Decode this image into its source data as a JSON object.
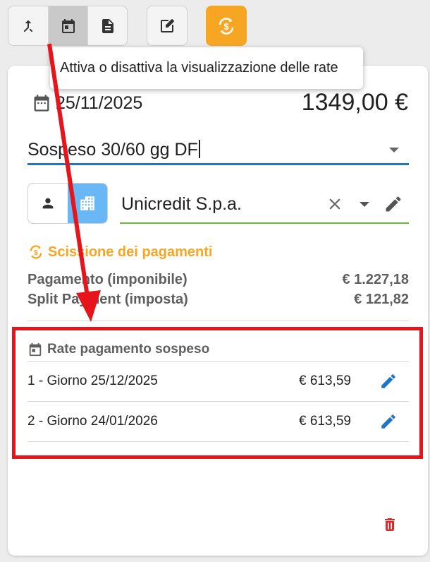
{
  "toolbar": {
    "buttons": [
      {
        "name": "merge-icon",
        "active": false
      },
      {
        "name": "calendar-icon",
        "active": true
      },
      {
        "name": "document-icon",
        "active": false
      }
    ],
    "edit_icon": "edit-note-icon",
    "split_icon": "currency-cycle-icon",
    "split_color": "#f6a623"
  },
  "tooltip": {
    "text": "Attiva o disattiva la visualizzazione delle rate"
  },
  "document": {
    "date": "25/11/2025",
    "amount": "1349,00 €"
  },
  "payment_method": {
    "value": "Sospeso 30/60 gg DF"
  },
  "customer": {
    "name": "Unicredit S.p.a."
  },
  "split_payment": {
    "title": "Scissione dei pagamenti",
    "rows": [
      {
        "label": "Pagamento (imponibile)",
        "value": "€ 1.227,18"
      },
      {
        "label": "Split Payment (imposta)",
        "value": "€ 121,82"
      }
    ]
  },
  "installments": {
    "title": "Rate pagamento sospeso",
    "rows": [
      {
        "label": "1 - Giorno 25/12/2025",
        "amount": "€ 613,59"
      },
      {
        "label": "2 - Giorno 24/01/2026",
        "amount": "€ 613,59"
      }
    ]
  },
  "colors": {
    "accent_blue": "#1e74c8",
    "highlight_red": "#e5151b",
    "success_green": "#6aba3a",
    "toggle_blue": "#6ab7f5"
  }
}
